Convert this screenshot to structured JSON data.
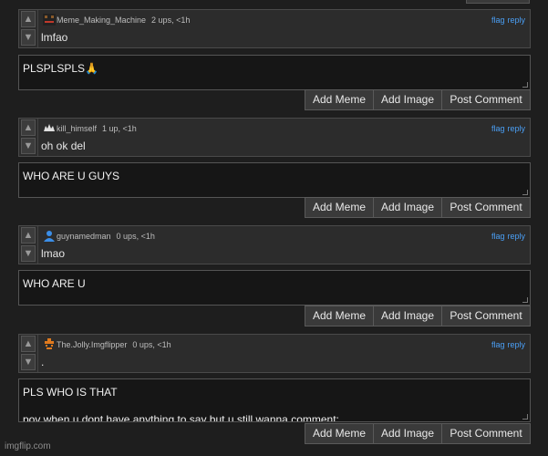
{
  "threads": [
    {
      "comment": {
        "user": "Meme_Making_Machine",
        "meta": "2 ups, <1h",
        "text": "lmfao"
      },
      "reply_text": "PLSPLSPLS🙏",
      "avatar_color": "#8a5a2a"
    },
    {
      "comment": {
        "user": "kill_himself",
        "meta": "1 up, <1h",
        "text": "oh ok del"
      },
      "reply_text": "WHO ARE U GUYS",
      "avatar_color": "#e0e0e0"
    },
    {
      "comment": {
        "user": "guynamedman",
        "meta": "0 ups, <1h",
        "text": "lmao"
      },
      "reply_text": "WHO ARE U",
      "avatar_color": "#3b8ee8"
    },
    {
      "comment": {
        "user": "The.Jolly.Imgflipper",
        "meta": "0 ups, <1h",
        "text": "."
      },
      "reply_text": "PLS WHO IS THAT\n\npov when u dont have anything to say but u still wanna comment:",
      "avatar_color": "#e07a1e"
    }
  ],
  "labels": {
    "flag": "flag",
    "reply": "reply",
    "add_meme": "Add Meme",
    "add_image": "Add Image",
    "post_comment": "Post Comment",
    "upvote": "▲",
    "downvote": "▼"
  },
  "footer": {
    "watermark": "imgflip.com"
  },
  "colors": {
    "link": "#4a9ff5",
    "background": "#1e1e1e"
  }
}
